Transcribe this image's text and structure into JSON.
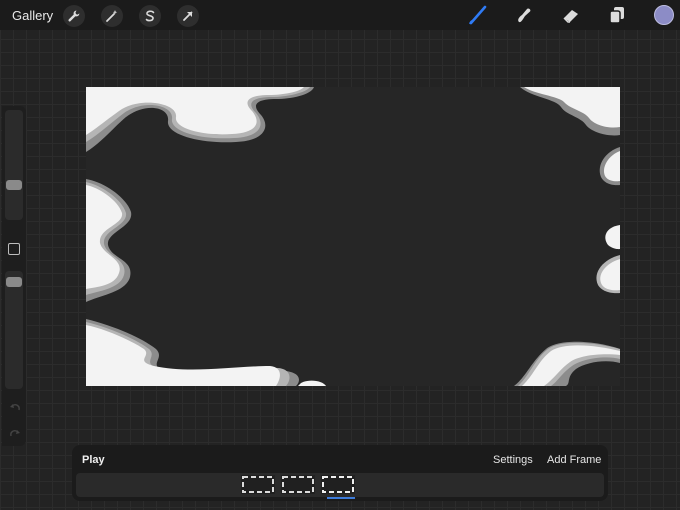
{
  "topbar": {
    "gallery_label": "Gallery",
    "actions": [
      {
        "name": "actions-wrench-icon"
      },
      {
        "name": "adjustments-wand-icon"
      },
      {
        "name": "selection-s-icon"
      },
      {
        "name": "transform-arrow-icon"
      }
    ],
    "tools": [
      {
        "name": "brush-icon",
        "active": true
      },
      {
        "name": "smudge-icon",
        "active": false
      },
      {
        "name": "eraser-icon",
        "active": false
      },
      {
        "name": "layers-icon",
        "active": false
      }
    ],
    "color_swatch": "#8c8cc6",
    "accent": "#2f7bf5"
  },
  "sidebar": {
    "brush_size_level": 0.65,
    "opacity_level": 0.05
  },
  "canvas": {
    "background": "#262626",
    "artwork_colors": [
      "#f3f3f3",
      "#b5b5b5",
      "#8c8c8c"
    ]
  },
  "animation": {
    "play_label": "Play",
    "settings_label": "Settings",
    "add_frame_label": "Add Frame",
    "frames_count": 3,
    "selected_frame": 3,
    "indicator_color": "#3d7bd9"
  }
}
